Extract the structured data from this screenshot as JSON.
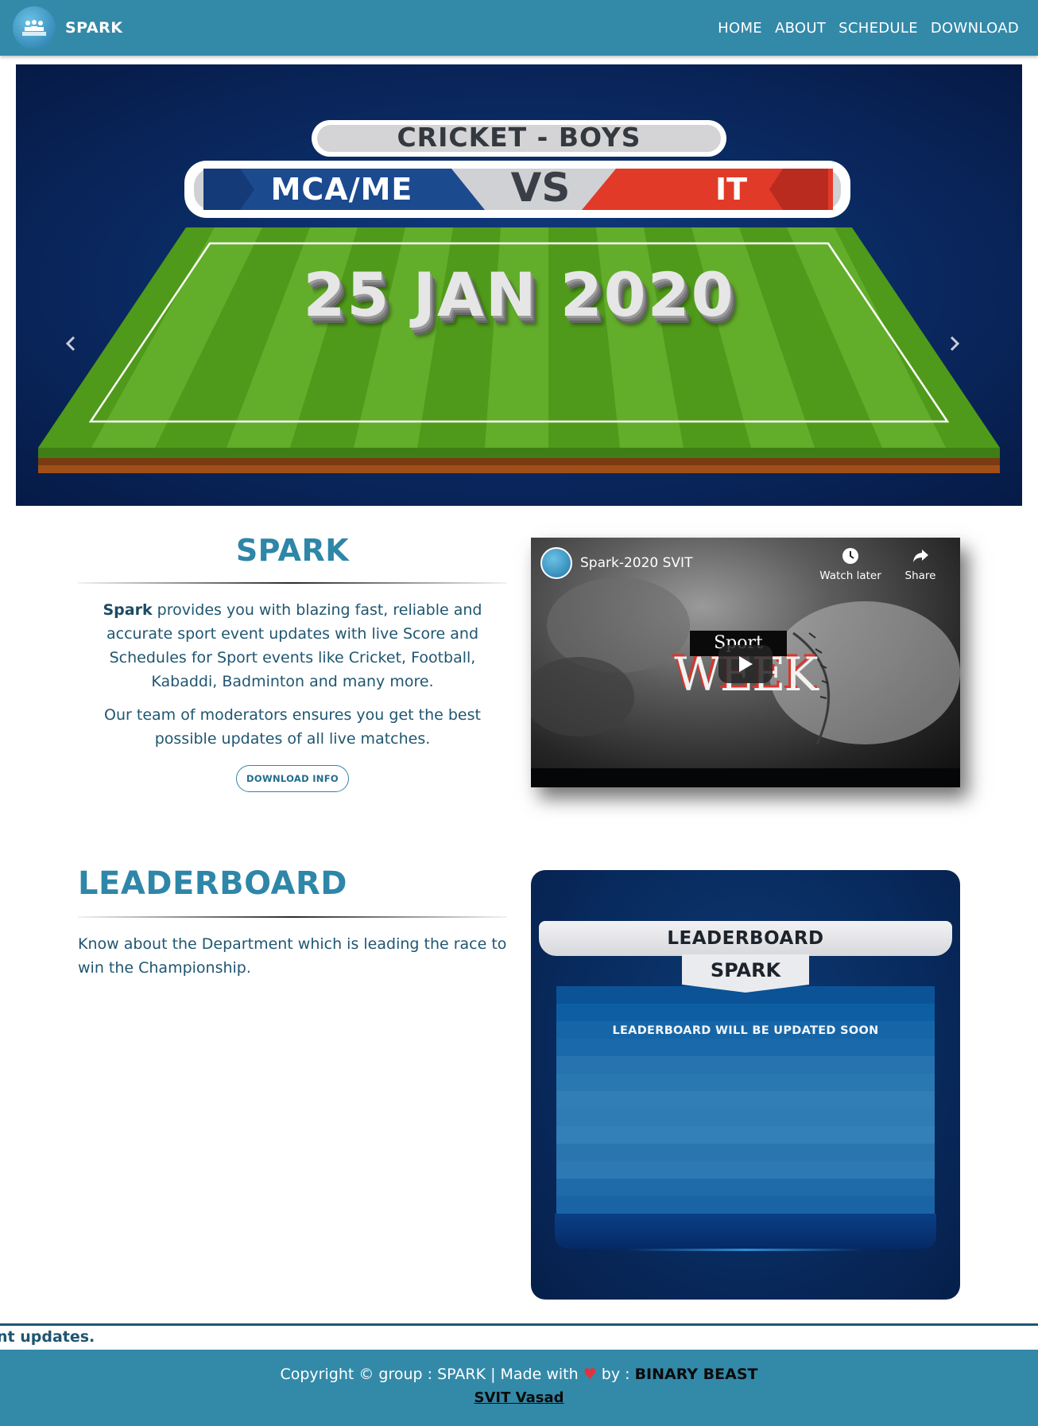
{
  "navbar": {
    "brand": "SPARK",
    "links": [
      "HOME",
      "ABOUT",
      "SCHEDULE",
      "DOWNLOAD"
    ],
    "color": "#3389a8"
  },
  "carousel": {
    "event": "CRICKET - BOYS",
    "team_left": "MCA/ME",
    "vs": "VS",
    "team_right": "IT",
    "date": "25 JAN 2020",
    "prev_icon": "chevron-left-icon",
    "next_icon": "chevron-right-icon"
  },
  "about": {
    "title": "SPARK",
    "p1_bold": "Spark",
    "p1_rest": " provides you with blazing fast, reliable and accurate sport event updates with live Score and Schedules for Sport events like Cricket, Football, Kabaddi, Badminton and many more.",
    "p2": "Our team of moderators ensures you get the best possible updates of all live matches.",
    "button": "DOWNLOAD INFO"
  },
  "video": {
    "title": "Spark-2020 SVIT",
    "watch_later": "Watch later",
    "share": "Share",
    "overlay_top": "Sport",
    "overlay_bottom": "WEEK"
  },
  "leaderboard": {
    "title": "LEADERBOARD",
    "description": "Know about the Department which is leading the race to win the Championship.",
    "card_header": "LEADERBOARD",
    "card_sub": "SPARK",
    "message": "LEADERBOARD WILL BE UPDATED SOON"
  },
  "ticker": {
    "text": "nt updates."
  },
  "footer": {
    "prefix": "Copyright © group : SPARK | Made with ",
    "heart": "♥",
    "by": " by : ",
    "team": "BINARY BEAST",
    "link": "SVIT Vasad"
  }
}
